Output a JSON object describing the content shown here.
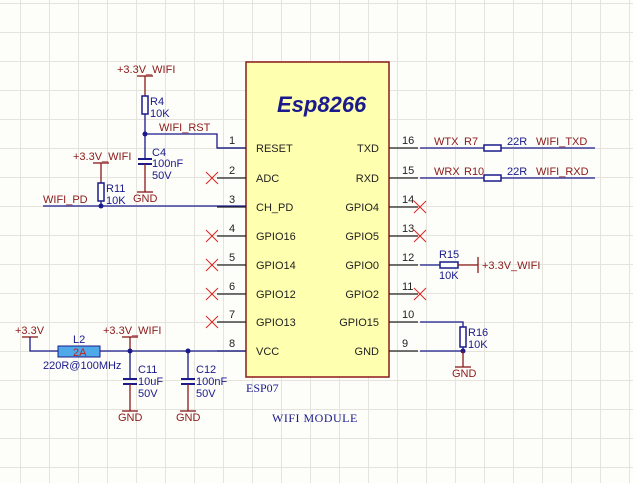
{
  "chip": {
    "name": "Esp8266",
    "part": "ESP07",
    "title": "WIFI MODULE",
    "fill": "#ffffb0",
    "border": "#8b1a1a",
    "left_pins": [
      {
        "num": "1",
        "name": "RESET"
      },
      {
        "num": "2",
        "name": "ADC"
      },
      {
        "num": "3",
        "name": "CH_PD"
      },
      {
        "num": "4",
        "name": "GPIO16"
      },
      {
        "num": "5",
        "name": "GPIO14"
      },
      {
        "num": "6",
        "name": "GPIO12"
      },
      {
        "num": "7",
        "name": "GPIO13"
      },
      {
        "num": "8",
        "name": "VCC"
      }
    ],
    "right_pins": [
      {
        "num": "16",
        "name": "TXD"
      },
      {
        "num": "15",
        "name": "RXD"
      },
      {
        "num": "14",
        "name": "GPIO4"
      },
      {
        "num": "13",
        "name": "GPIO5"
      },
      {
        "num": "12",
        "name": "GPIO0"
      },
      {
        "num": "11",
        "name": "GPIO2"
      },
      {
        "num": "10",
        "name": "GPIO15"
      },
      {
        "num": "9",
        "name": "GND"
      }
    ]
  },
  "power": {
    "v33wifi": "+3.3V_WIFI",
    "v33": "+3.3V",
    "gnd": "GND"
  },
  "nets": {
    "rst": "WIFI_RST",
    "pd": "WIFI_PD",
    "wtx": "WTX",
    "wrx": "WRX",
    "txd": "WIFI_TXD",
    "rxd": "WIFI_RXD"
  },
  "parts": {
    "r4": {
      "ref": "R4",
      "val": "10K"
    },
    "c4": {
      "ref": "C4",
      "val": "100nF",
      "volt": "50V"
    },
    "r11": {
      "ref": "R11",
      "val": "10K"
    },
    "l2": {
      "ref": "L2",
      "rating": "2A",
      "val": "220R@100MHz"
    },
    "c11": {
      "ref": "C11",
      "val": "10uF",
      "volt": "50V"
    },
    "c12": {
      "ref": "C12",
      "val": "100nF",
      "volt": "50V"
    },
    "r7": {
      "ref": "R7",
      "val": "22R"
    },
    "r10": {
      "ref": "R10",
      "val": "22R"
    },
    "r15": {
      "ref": "R15",
      "val": "10K"
    },
    "r16": {
      "ref": "R16",
      "val": "10K"
    }
  }
}
